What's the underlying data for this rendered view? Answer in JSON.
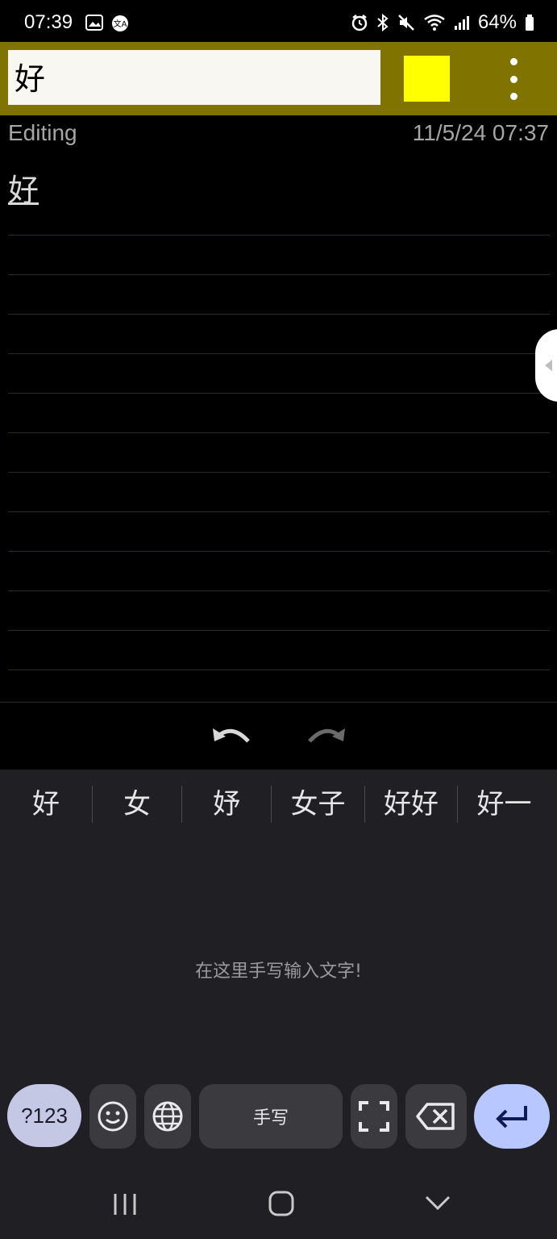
{
  "status_bar": {
    "time": "07:39",
    "battery": "64%",
    "icons": [
      "gallery-icon",
      "translate-icon",
      "alarm-icon",
      "bluetooth-icon",
      "mute-icon",
      "wifi-icon",
      "signal-icon",
      "battery-icon"
    ]
  },
  "toolbar": {
    "title_value": "好",
    "color_swatch": "#ffff00",
    "accent_color": "#807300"
  },
  "note": {
    "status": "Editing",
    "timestamp": "11/5/24 07:37",
    "body": "好"
  },
  "undo_bar": {
    "icons": [
      "undo-icon",
      "redo-icon"
    ]
  },
  "keyboard": {
    "candidates": [
      "好",
      "女",
      "妤",
      "女子",
      "好好",
      "好一"
    ],
    "hint": "在这里手写输入文字!",
    "keys": {
      "symbols": "?123",
      "space": "手写"
    }
  }
}
